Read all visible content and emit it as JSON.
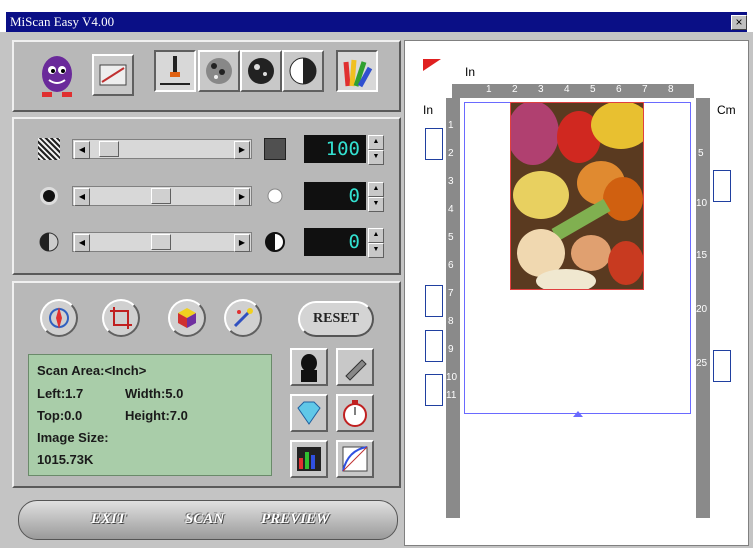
{
  "window": {
    "title": "MiScan Easy V4.00",
    "close": "×"
  },
  "adjust": {
    "rows": [
      {
        "value": "100"
      },
      {
        "value": "0"
      },
      {
        "value": "0"
      }
    ]
  },
  "reset_label": "RESET",
  "info": {
    "scan_area": "Scan Area:<Inch>",
    "left": "Left:1.7",
    "width": "Width:5.0",
    "top": "Top:0.0",
    "height": "Height:7.0",
    "image_size_label": "Image Size:",
    "image_size": "1015.73K"
  },
  "footer": {
    "exit": "EXIT",
    "scan": "SCAN",
    "preview": "PREVIEW"
  },
  "preview": {
    "unit_top": "In",
    "unit_left": "In",
    "unit_right": "Cm",
    "ruler_top": [
      "1",
      "2",
      "3",
      "4",
      "5",
      "6",
      "7",
      "8"
    ],
    "ruler_left": [
      "1",
      "2",
      "3",
      "4",
      "5",
      "6",
      "7",
      "8",
      "9",
      "10",
      "11"
    ],
    "ruler_right": [
      "5",
      "10",
      "15",
      "20",
      "25"
    ]
  },
  "colors": {
    "title_bar": "#0a0f86",
    "lcd_text": "#33e0d0",
    "info_panel": "#a9cda9",
    "scan_area_border": "#6a6aff",
    "crop_border": "#e04040"
  }
}
